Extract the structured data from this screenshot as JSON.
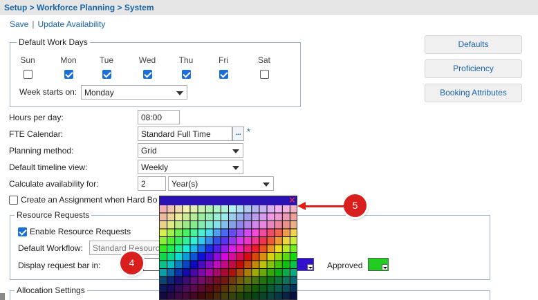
{
  "breadcrumb": "Setup > Workforce Planning > System",
  "toolbar": {
    "save": "Save",
    "separator": "|",
    "update": "Update Availability"
  },
  "work_days": {
    "legend": "Default Work Days",
    "days": [
      {
        "label": "Sun",
        "checked": false
      },
      {
        "label": "Mon",
        "checked": true
      },
      {
        "label": "Tue",
        "checked": true
      },
      {
        "label": "Wed",
        "checked": true
      },
      {
        "label": "Thu",
        "checked": true
      },
      {
        "label": "Fri",
        "checked": true
      },
      {
        "label": "Sat",
        "checked": false
      }
    ],
    "week_starts_label": "Week starts on:",
    "week_starts_value": "Monday"
  },
  "side_buttons": {
    "defaults": "Defaults",
    "proficiency": "Proficiency",
    "booking": "Booking Attributes"
  },
  "form": {
    "hours_label": "Hours per day:",
    "hours_value": "08:00",
    "fte_label": "FTE Calendar:",
    "fte_value": "Standard Full Time",
    "fte_button": "...",
    "required_mark": "*",
    "planning_label": "Planning method:",
    "planning_value": "Grid",
    "timeline_label": "Default timeline view:",
    "timeline_value": "Weekly",
    "calc_label": "Calculate availability for:",
    "calc_number": "2",
    "calc_unit": "Year(s)",
    "create_assignment_label": "Create an Assignment when Hard Bo"
  },
  "resource_requests": {
    "legend": "Resource Requests",
    "enable_label": "Enable Resource Requests",
    "enable_checked": true,
    "workflow_label": "Default Workflow:",
    "workflow_value": "Standard Resourc",
    "display_bar_label": "Display request bar in:",
    "approved_label": "Approved",
    "approved_color": "#22cc22",
    "pending_color": "#3311cc"
  },
  "allocation": {
    "legend": "Allocation Settings"
  },
  "color_picker": {
    "close": "✕",
    "header_color": "#2a12b5"
  },
  "callouts": {
    "four": "4",
    "five": "5"
  }
}
